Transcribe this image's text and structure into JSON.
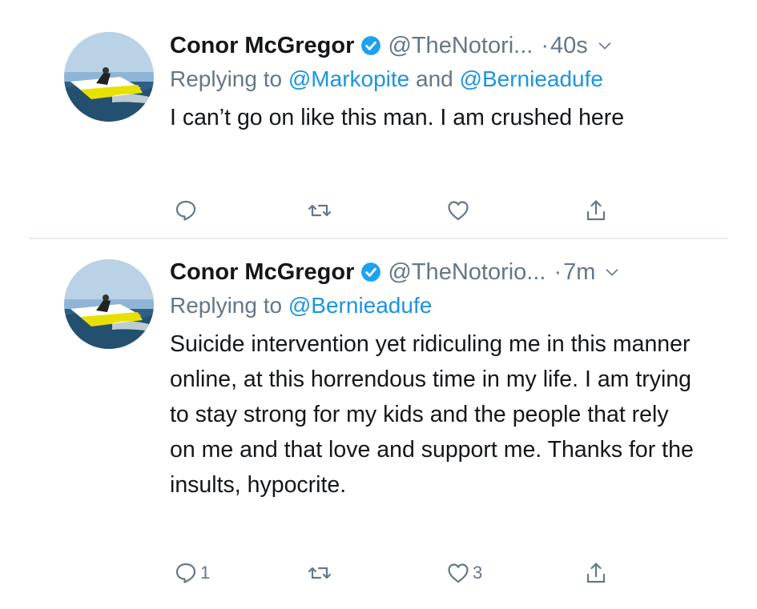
{
  "tweets": [
    {
      "name": "Conor McGregor",
      "handle": "@TheNotori...",
      "separator": "·",
      "time": "40s",
      "reply_prefix": "Replying to ",
      "reply_mention_1": "@Markopite",
      "reply_and": " and ",
      "reply_mention_2": "@Bernieadufe",
      "text": "I can’t go on like this man. I am crushed here",
      "reply_count": "",
      "retweet_count": "",
      "like_count": ""
    },
    {
      "name": "Conor McGregor",
      "handle": "@TheNotorio...",
      "separator": "·",
      "time": "7m",
      "reply_prefix": "Replying to ",
      "reply_mention_1": "@Bernieadufe",
      "text": "Suicide intervention yet ridiculing me in this manner online, at this horrendous time in my life. I am trying to stay strong for my kids and the people that rely on me and that love and support me. Thanks for the insults, hypocrite.",
      "reply_count": "1",
      "retweet_count": "",
      "like_count": "3"
    }
  ],
  "colors": {
    "text": "#14171a",
    "secondary": "#657786",
    "link": "#1b95e0",
    "verified": "#1da1f2",
    "divider": "#e6ecf0"
  },
  "icons": {
    "verified": "verified-badge-icon",
    "caret": "chevron-down-icon",
    "reply": "reply-icon",
    "retweet": "retweet-icon",
    "like": "heart-icon",
    "share": "share-icon"
  }
}
